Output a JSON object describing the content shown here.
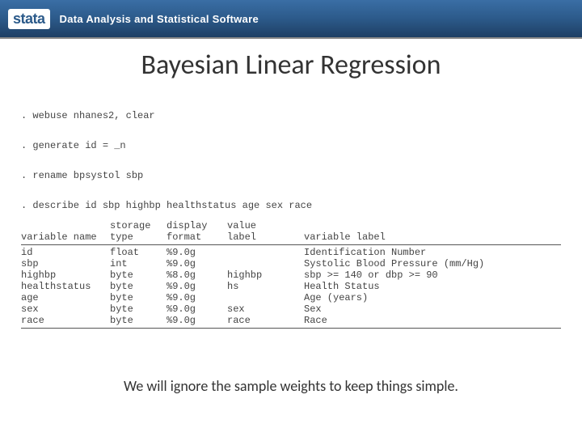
{
  "header": {
    "logo_text": "stata",
    "tagline": "Data Analysis and Statistical Software"
  },
  "title": "Bayesian Linear Regression",
  "commands": [
    ". webuse nhanes2, clear",
    ". generate id = _n",
    ". rename bpsystol sbp",
    ". describe id sbp highbp healthstatus age sex race"
  ],
  "table_headers": {
    "name": "variable name",
    "storage": "storage",
    "type": "type",
    "display": "display",
    "format": "format",
    "value": "value",
    "label": "label",
    "varlabel": "variable label"
  },
  "vars": [
    {
      "name": "id",
      "type": "float",
      "fmt": "%9.0g",
      "vlab": "",
      "label": "Identification Number"
    },
    {
      "name": "sbp",
      "type": "int",
      "fmt": "%9.0g",
      "vlab": "",
      "label": "Systolic Blood Pressure (mm/Hg)"
    },
    {
      "name": "highbp",
      "type": "byte",
      "fmt": "%8.0g",
      "vlab": "highbp",
      "label": "sbp >= 140 or dbp >= 90"
    },
    {
      "name": "healthstatus",
      "type": "byte",
      "fmt": "%9.0g",
      "vlab": "hs",
      "label": "Health Status"
    },
    {
      "name": "age",
      "type": "byte",
      "fmt": "%9.0g",
      "vlab": "",
      "label": "Age (years)"
    },
    {
      "name": "sex",
      "type": "byte",
      "fmt": "%9.0g",
      "vlab": "sex",
      "label": "Sex"
    },
    {
      "name": "race",
      "type": "byte",
      "fmt": "%9.0g",
      "vlab": "race",
      "label": "Race"
    }
  ],
  "footer": "We will ignore the sample weights to keep things simple."
}
